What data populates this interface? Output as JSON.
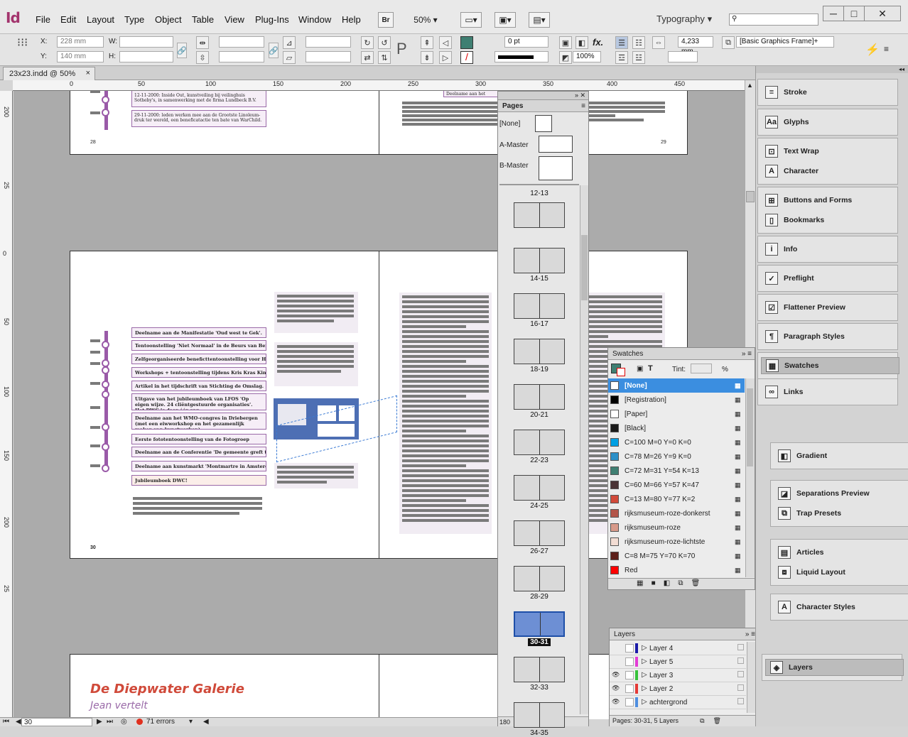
{
  "app": {
    "logo": "Id"
  },
  "menu": [
    "File",
    "Edit",
    "Layout",
    "Type",
    "Object",
    "Table",
    "View",
    "Plug-Ins",
    "Window",
    "Help"
  ],
  "toolbar": {
    "bridge": "Br",
    "zoom": "50%",
    "workspace": "Typography",
    "search_placeholder": ""
  },
  "control": {
    "x_label": "X:",
    "x_value": "228 mm",
    "y_label": "Y:",
    "y_value": "140 mm",
    "w_label": "W:",
    "h_label": "H:",
    "stroke_weight": "0 pt",
    "opacity": "100%",
    "gap": "4,233 mm",
    "object_style": "[Basic Graphics Frame]+"
  },
  "document": {
    "tab_title": "23x23.indd @ 50%"
  },
  "ruler_top": [
    "0",
    "50",
    "100",
    "150",
    "200",
    "250",
    "300",
    "350",
    "400",
    "450"
  ],
  "ruler_left": [
    "200",
    "25",
    "0",
    "50",
    "100",
    "150",
    "200",
    "25"
  ],
  "spreads": {
    "top_left_page_num": "28",
    "top_right_page_num": "29",
    "top_notes": [
      "12-11-2000: Inside Out, kunstveiling bij veilinghuis Sotheby's, in samenwerking met de firma Lundbeck B.V.",
      "29-11-2000: leden werken mee aan de Grootste Linoleum-druk ter wereld, een beneficatactie ten bate van WarChild."
    ],
    "top_right_note": "Deelname aan het Kwart",
    "main_left_page_num": "30",
    "timeline": [
      "Deelname aan de Manifestatie 'Oud west te Gek'.",
      "Tentoonstelling 'Niet Normaal' in de Beurs van Berlage.",
      "Zelfgeorganiseerde beneficttentoonstelling voor Haiti.",
      "Workshops + tentoonstelling tijdens Kris Kras KinkerKunst.",
      "Artikel in het tijdschrift van Stichting de Omslag.",
      "Uitgave van het jubileumboek van LFOS 'Op eigen wijze. 24 cliëntgestuurde organisaties'. Het DWC is daar één van.",
      "Deelname aan het WMO-congres in Driebergen (met een eiwworkshop en het gezamenlijk maken van kunstwerken).",
      "Eerste fototentoonstelling van de Fotogroep",
      "Deelname aan de Conferentie 'De gemeente greft thuis'",
      "Deelname aan kunstmarkt 'Montmartre in Amsterdam'",
      "Jubileumboek DWC!"
    ],
    "bottom_title": "De Diepwater Galerie",
    "bottom_subtitle": "Jean vertelt"
  },
  "pages_panel": {
    "title": "Pages",
    "masters": [
      "[None]",
      "A-Master",
      "B-Master"
    ],
    "spreads": [
      "12-13",
      "14-15",
      "16-17",
      "18-19",
      "20-21",
      "22-23",
      "24-25",
      "26-27",
      "28-29",
      "30-31",
      "32-33",
      "34-35"
    ],
    "selected": "30-31",
    "footer_count": "180"
  },
  "swatches_panel": {
    "title": "Swatches",
    "tint_label": "Tint:",
    "tint_unit": "%",
    "items": [
      {
        "name": "[None]",
        "color": "#ffffff",
        "selected": true
      },
      {
        "name": "[Registration]",
        "color": "#000000"
      },
      {
        "name": "[Paper]",
        "color": "#ffffff"
      },
      {
        "name": "[Black]",
        "color": "#1a1a1a"
      },
      {
        "name": "C=100 M=0 Y=0 K=0",
        "color": "#00a0e3"
      },
      {
        "name": "C=78 M=26 Y=9 K=0",
        "color": "#2c90c8"
      },
      {
        "name": "C=72 M=31 Y=54 K=13",
        "color": "#3f7f72"
      },
      {
        "name": "C=60 M=66 Y=57 K=47",
        "color": "#4a3335"
      },
      {
        "name": "C=13 M=80 Y=77 K=2",
        "color": "#d24a3a"
      },
      {
        "name": "rijksmuseum-roze-donkerst",
        "color": "#b3564a"
      },
      {
        "name": "rijksmuseum-roze",
        "color": "#d89a8a"
      },
      {
        "name": "rijksmuseum-roze-lichtste",
        "color": "#f2dcd3"
      },
      {
        "name": "C=8 M=75 Y=70 K=70",
        "color": "#5c1f1a"
      },
      {
        "name": "Red",
        "color": "#ff0000"
      }
    ]
  },
  "layers_panel": {
    "title": "Layers",
    "items": [
      {
        "name": "Layer 4",
        "color": "#1a1aa8",
        "visible": false
      },
      {
        "name": "Layer 5",
        "color": "#e33bd6",
        "visible": false
      },
      {
        "name": "Layer 3",
        "color": "#36c23a",
        "visible": true
      },
      {
        "name": "Layer 2",
        "color": "#e53935",
        "visible": true
      },
      {
        "name": "achtergrond",
        "color": "#4f8fe0",
        "visible": true
      }
    ],
    "footer": "Pages: 30-31, 5 Layers"
  },
  "dock": {
    "groups": [
      [
        "Stroke"
      ],
      [
        "Glyphs"
      ],
      [
        "Text Wrap",
        "Character"
      ],
      [
        "Buttons and Forms",
        "Bookmarks"
      ],
      [
        "Info"
      ],
      [
        "Preflight"
      ],
      [
        "Flattener Preview"
      ],
      [
        "Paragraph Styles"
      ],
      [
        "Swatches"
      ],
      [
        "Links"
      ],
      [
        "Gradient"
      ],
      [
        "Separations Preview",
        "Trap Presets"
      ],
      [
        "Articles",
        "Liquid Layout"
      ],
      [
        "Character Styles"
      ],
      [
        "Layers"
      ]
    ]
  },
  "status": {
    "page": "30",
    "errors": "71 errors"
  }
}
